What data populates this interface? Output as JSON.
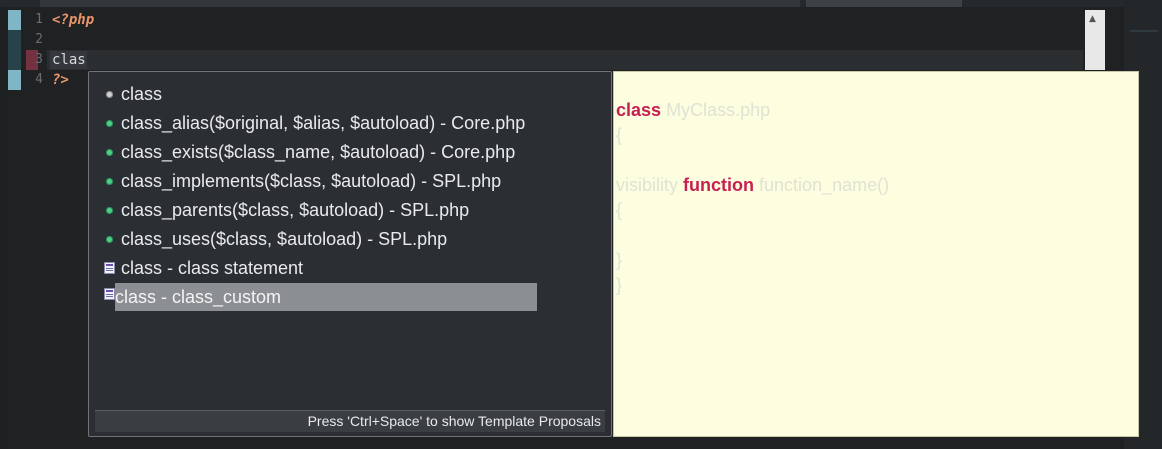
{
  "editor": {
    "line_numbers": [
      "1",
      "2",
      "3",
      "4"
    ],
    "lines": [
      "<?php",
      "",
      "clas",
      "?>"
    ]
  },
  "completion": {
    "items": [
      {
        "label": "class",
        "icon": "keyword-icon"
      },
      {
        "label": "class_alias($original, $alias, $autoload) - Core.php",
        "icon": "function-icon"
      },
      {
        "label": "class_exists($class_name, $autoload) - Core.php",
        "icon": "function-icon"
      },
      {
        "label": "class_implements($class, $autoload) - SPL.php",
        "icon": "function-icon"
      },
      {
        "label": "class_parents($class, $autoload) - SPL.php",
        "icon": "function-icon"
      },
      {
        "label": "class_uses($class, $autoload) - SPL.php",
        "icon": "function-icon"
      },
      {
        "label": "class - class statement",
        "icon": "template-icon"
      },
      {
        "label": "class - class_custom",
        "icon": "template-icon",
        "selected": true
      }
    ],
    "footer": "Press 'Ctrl+Space' to show Template Proposals"
  },
  "preview": {
    "line1_kw": "class",
    "line1_rest": "MyClass.php",
    "line2": "{",
    "line3_pre": "visibility",
    "line3_kw": "function",
    "line3_rest": "function_name()",
    "line4": "{",
    "line5": "}",
    "line6": "}"
  }
}
